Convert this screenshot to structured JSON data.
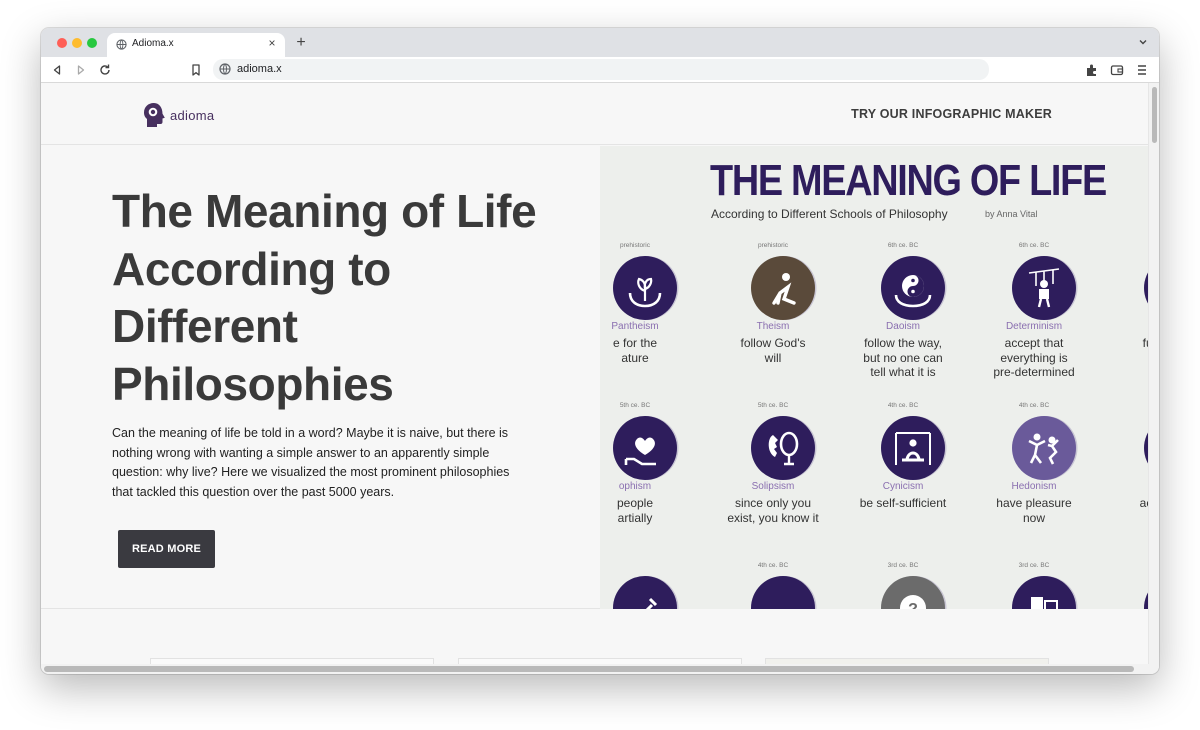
{
  "browser": {
    "tab_title": "Adioma.x",
    "tab_close": "×",
    "new_tab": "+",
    "url": "adioma.x"
  },
  "site": {
    "logo_text": "adioma",
    "nav_cta": "TRY OUR INFOGRAPHIC MAKER"
  },
  "hero": {
    "title": "The Meaning of Life According to Different Philosophies",
    "description": "Can the meaning of life be told in a word? Maybe it is naive, but there is nothing wrong with wanting a simple answer to an apparently simple question: why live? Here we visualized the most prominent philosophies that tackled this question over the past 5000 years.",
    "button": "READ MORE"
  },
  "infographic": {
    "title": "THE MEANING OF LIFE",
    "subtitle": "According to Different Schools of Philosophy",
    "byline": "by Anna Vital",
    "row1": [
      {
        "era": "prehistoric",
        "name": "Pantheism",
        "phrase": "e for the\nature",
        "icon": "hands-plant-icon",
        "color": "#2e1d5c"
      },
      {
        "era": "prehistoric",
        "name": "Theism",
        "phrase": "follow God's\nwill",
        "icon": "praying-figure-icon",
        "color": "#5a4a3a"
      },
      {
        "era": "6th ce. BC",
        "name": "Daoism",
        "phrase": "follow the way,\nbut no one can\ntell what it is",
        "icon": "yin-yang-icon",
        "color": "#2e1d5c"
      },
      {
        "era": "6th ce. BC",
        "name": "Determinism",
        "phrase": "accept that\neverything is\npre-determined",
        "icon": "puppet-icon",
        "color": "#2e1d5c"
      },
      {
        "era": "5th c",
        "name": "Confuc",
        "phrase": "fulfill you\nto ot",
        "icon": "person-icon",
        "color": "#2e1d5c"
      }
    ],
    "row2": [
      {
        "era": "5th ce. BC",
        "name": "ophism",
        "phrase": "people\nartially",
        "icon": "heart-hand-icon",
        "color": "#2e1d5c"
      },
      {
        "era": "5th ce. BC",
        "name": "Solipsism",
        "phrase": "since only you\nexist, you know it",
        "icon": "mirror-icon",
        "color": "#2e1d5c"
      },
      {
        "era": "4th ce. BC",
        "name": "Cynicism",
        "phrase": "be self-sufficient",
        "icon": "meditating-icon",
        "color": "#2e1d5c"
      },
      {
        "era": "4th ce. BC",
        "name": "Hedonism",
        "phrase": "have pleasure\nnow",
        "icon": "dancing-icon",
        "color": "#6a5a9a"
      },
      {
        "era": "4th c",
        "name": "Plato",
        "phrase": "acquire m\nknow",
        "icon": "book-icon",
        "color": "#2e1d5c"
      }
    ],
    "row3": [
      {
        "era": "",
        "icon": "tools-icon",
        "color": "#2e1d5c"
      },
      {
        "era": "4th ce. BC",
        "icon": "circle-icon",
        "color": "#2e1d5c"
      },
      {
        "era": "3rd ce. BC",
        "icon": "question-icon",
        "color": "#6b6b6b"
      },
      {
        "era": "3rd ce. BC",
        "icon": "masks-icon",
        "color": "#2e1d5c"
      },
      {
        "era": "3rd c",
        "icon": "gear-icon",
        "color": "#2e1d5c"
      }
    ]
  }
}
